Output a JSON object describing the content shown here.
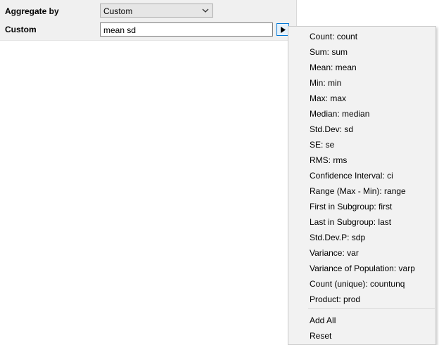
{
  "form": {
    "aggregate_label": "Aggregate by",
    "aggregate_value": "Custom",
    "custom_label": "Custom",
    "custom_value": "mean sd"
  },
  "menu": {
    "items": [
      "Count: count",
      "Sum: sum",
      "Mean: mean",
      "Min: min",
      "Max: max",
      "Median: median",
      "Std.Dev: sd",
      "SE: se",
      "RMS: rms",
      "Confidence Interval: ci",
      "Range (Max - Min): range",
      "First in Subgroup: first",
      "Last in Subgroup: last",
      "Std.Dev.P: sdp",
      "Variance: var",
      "Variance of Population: varp",
      "Count (unique): countunq",
      "Product: prod"
    ],
    "actions": [
      "Add All",
      "Reset"
    ]
  },
  "icons": {
    "dropdown": "chevron-down-icon",
    "menu_button": "play-arrow-icon"
  },
  "colors": {
    "panel_background": "#f0f0f0",
    "button_highlight_border": "#0078d7",
    "button_highlight_fill": "#e5f1fb",
    "menu_background": "#f2f2f2"
  }
}
